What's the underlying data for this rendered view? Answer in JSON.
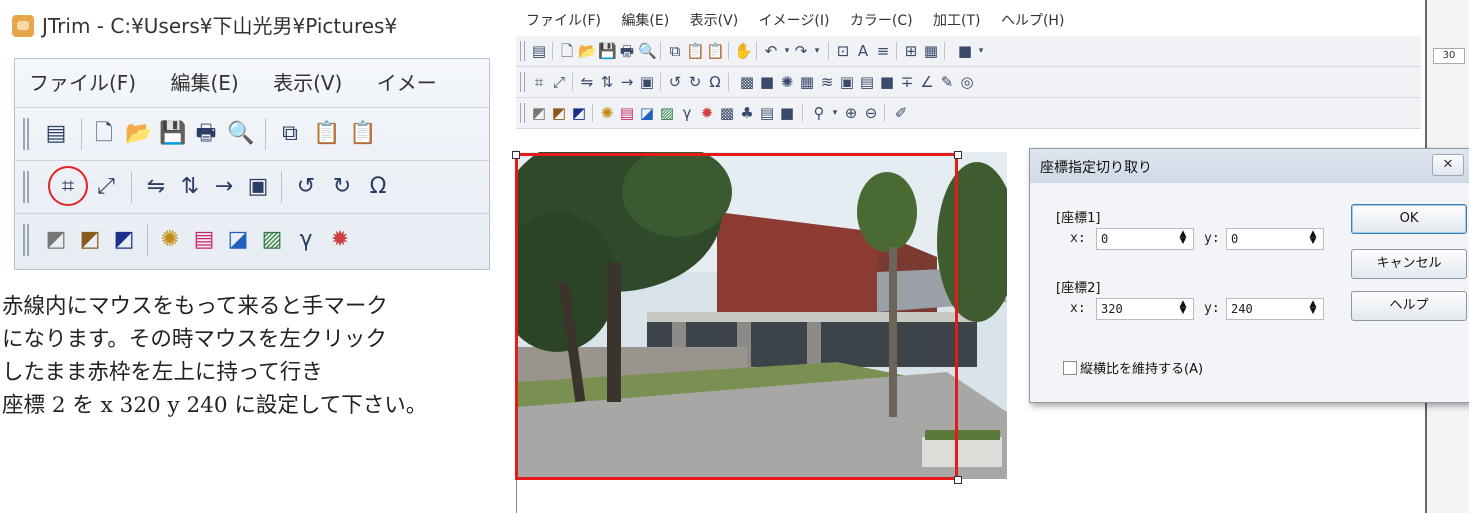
{
  "left_panel": {
    "title": "JTrim - C:¥Users¥下山光男¥Pictures¥",
    "menu": [
      "ファイル(F)",
      "編集(E)",
      "表示(V)",
      "イメー"
    ],
    "instructions": [
      "赤線内にマウスをもって来ると手マーク",
      "になります。その時マウスを左クリック",
      "したまま赤枠を左上に持って行き",
      "座標 2 を x 320 y 240 に設定して下さい。"
    ]
  },
  "app": {
    "menu": [
      "ファイル(F)",
      "編集(E)",
      "表示(V)",
      "イメージ(I)",
      "カラー(C)",
      "加工(T)",
      "ヘルプ(H)"
    ],
    "edge_number": "30"
  },
  "dialog": {
    "title": "座標指定切り取り",
    "close_label": "✕",
    "coord1_label": "[座標1]",
    "coord2_label": "[座標2]",
    "x_label": "x:",
    "y_label": "y:",
    "x1": "0",
    "y1": "0",
    "x2": "320",
    "y2": "240",
    "ok_label": "OK",
    "cancel_label": "キャンセル",
    "help_label": "ヘルプ",
    "keep_ratio_label": "縦横比を維持する(A)",
    "keep_ratio_checked": false
  },
  "colors": {
    "highlight_red": "#e51b1b",
    "window_bg": "#f2f4f7"
  }
}
